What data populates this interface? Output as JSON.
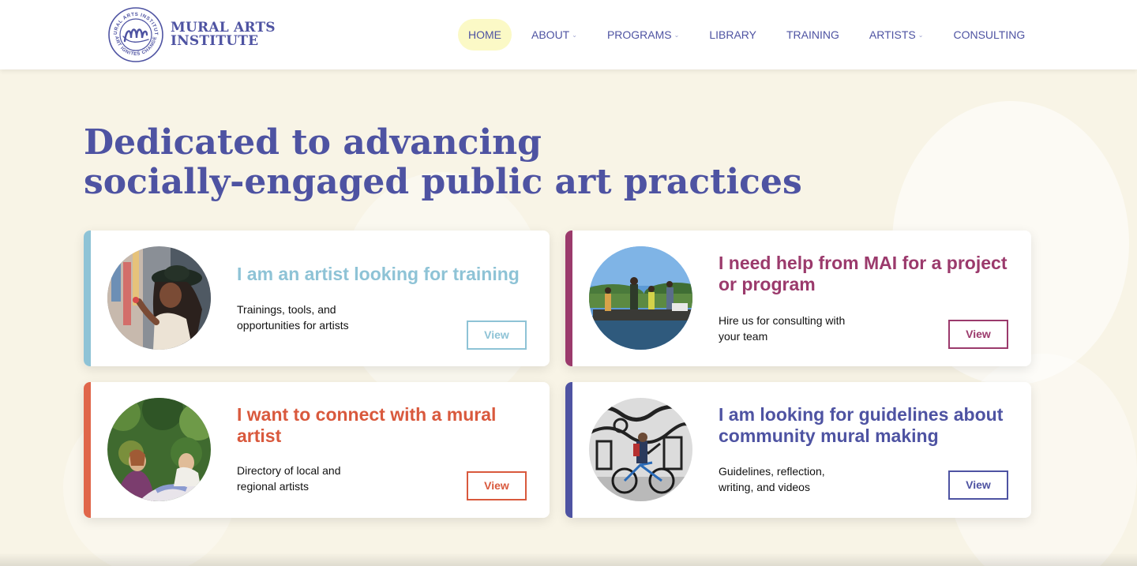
{
  "brand": {
    "name_line1": "MURAL ARTS",
    "name_line2": "INSTITUTE",
    "seal_top_text": "MURAL ARTS INSTITUTE",
    "seal_bottom_text": "ART IGNITES CHANGE",
    "color": "#4e53a2"
  },
  "nav": {
    "items": [
      {
        "label": "HOME",
        "active": true,
        "has_dropdown": false
      },
      {
        "label": "ABOUT",
        "active": false,
        "has_dropdown": true
      },
      {
        "label": "PROGRAMS",
        "active": false,
        "has_dropdown": true
      },
      {
        "label": "LIBRARY",
        "active": false,
        "has_dropdown": false
      },
      {
        "label": "TRAINING",
        "active": false,
        "has_dropdown": false
      },
      {
        "label": "ARTISTS",
        "active": false,
        "has_dropdown": true
      },
      {
        "label": "CONSULTING",
        "active": false,
        "has_dropdown": false
      }
    ],
    "dropdown_icon": "chevron-down-icon"
  },
  "hero": {
    "headline_line1": "Dedicated to advancing",
    "headline_line2": "socially-engaged public art practices"
  },
  "cards": [
    {
      "title": "I am an artist looking for training",
      "desc_line1": "Trainings, tools, and",
      "desc_line2": "opportunities for artists",
      "button": "View",
      "accent": "#8ec3d6",
      "title_color": "#8ec3d6",
      "image": "artist-painting-wall-photo"
    },
    {
      "title": "I need help from MAI for a project or program",
      "desc_line1": "Hire us for consulting with",
      "desc_line2": "your team",
      "button": "View",
      "accent": "#9b3a6c",
      "title_color": "#9b3a6c",
      "image": "workers-on-barge-photo"
    },
    {
      "title": "I want to connect with a mural artist",
      "desc_line1": "Directory of local and",
      "desc_line2": "regional artists",
      "button": "View",
      "accent": "#e0664a",
      "title_color": "#d9593d",
      "image": "painting-of-figures-photo"
    },
    {
      "title": "I am looking for guidelines about community mural making",
      "desc_line1": "Guidelines, reflection,",
      "desc_line2": "writing, and videos",
      "button": "View",
      "accent": "#4e53a2",
      "title_color": "#4e53a2",
      "image": "cyclist-mural-photo"
    }
  ],
  "colors": {
    "background": "#f8f4e6",
    "active_nav_bg": "#fbf9c6"
  }
}
